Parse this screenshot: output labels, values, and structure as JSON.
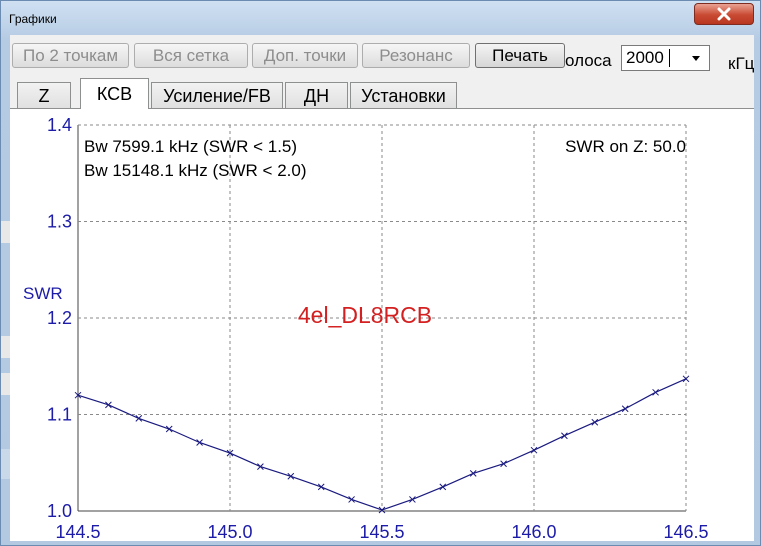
{
  "window": {
    "title": "Графики"
  },
  "toolbar": {
    "buttons": [
      {
        "label": "По 2 точкам",
        "enabled": false
      },
      {
        "label": "Вся сетка",
        "enabled": false
      },
      {
        "label": "Доп. точки",
        "enabled": false
      },
      {
        "label": "Резонанс",
        "enabled": false
      },
      {
        "label": "Печать",
        "enabled": true
      }
    ],
    "band_label": "олоса",
    "band_value": "2000",
    "band_units": "кГц"
  },
  "tabs": [
    {
      "label": "Z",
      "selected": false
    },
    {
      "label": "КСВ",
      "selected": true
    },
    {
      "label": "Усиление/FB",
      "selected": false
    },
    {
      "label": "ДН",
      "selected": false
    },
    {
      "label": "Установки",
      "selected": false
    }
  ],
  "chart_data": {
    "type": "line",
    "ylabel": "SWR",
    "xlabel": "",
    "xlim": [
      144.5,
      146.5
    ],
    "ylim": [
      1.0,
      1.4
    ],
    "xticks": [
      "144.5",
      "145.0",
      "145.5",
      "146.0",
      "146.5"
    ],
    "yticks": [
      "1.0",
      "1.1",
      "1.2",
      "1.3",
      "1.4"
    ],
    "grid": true,
    "annotations": {
      "bw1": "Bw 7599.1 kHz (SWR < 1.5)",
      "bw2": "Bw 15148.1 kHz (SWR < 2.0)",
      "swr_on_z": "SWR on Z: 50.0",
      "model_name": "4el_DL8RCB"
    },
    "colors": {
      "axis_text": "#1c1ca8",
      "line": "#1a1a80",
      "model_name": "#d42020"
    },
    "series": [
      {
        "x": [
          144.5,
          144.6,
          144.7,
          144.8,
          144.9,
          145.0,
          145.1,
          145.2,
          145.3,
          145.4,
          145.5,
          145.6,
          145.7,
          145.8,
          145.9,
          146.0,
          146.1,
          146.2,
          146.3,
          146.4,
          146.5
        ],
        "values": [
          1.12,
          1.11,
          1.096,
          1.085,
          1.071,
          1.06,
          1.046,
          1.036,
          1.025,
          1.012,
          1.001,
          1.012,
          1.025,
          1.039,
          1.049,
          1.063,
          1.078,
          1.092,
          1.106,
          1.123,
          1.137
        ]
      }
    ]
  }
}
